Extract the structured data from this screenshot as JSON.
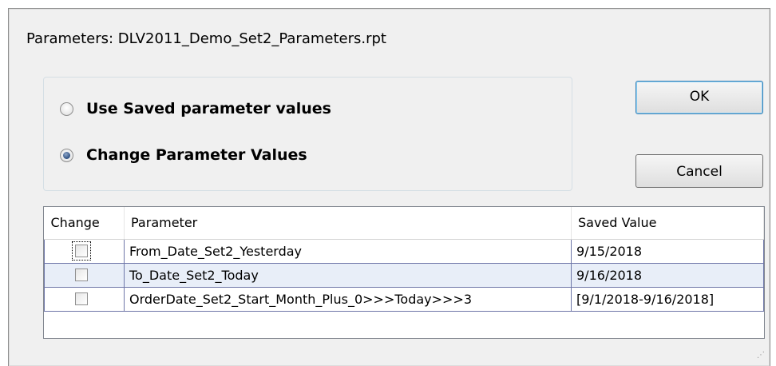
{
  "dialog": {
    "title": "Parameters: DLV2011_Demo_Set2_Parameters.rpt"
  },
  "options": [
    {
      "label": "Use Saved parameter values",
      "selected": false
    },
    {
      "label": "Change Parameter Values",
      "selected": true
    }
  ],
  "buttons": {
    "ok_label": "OK",
    "cancel_label": "Cancel"
  },
  "grid": {
    "headers": {
      "change": "Change",
      "parameter": "Parameter",
      "saved_value": "Saved Value"
    },
    "rows": [
      {
        "change": false,
        "parameter": "From_Date_Set2_Yesterday",
        "saved_value": "9/15/2018"
      },
      {
        "change": false,
        "parameter": "To_Date_Set2_Today",
        "saved_value": "9/16/2018"
      },
      {
        "change": false,
        "parameter": "OrderDate_Set2_Start_Month_Plus_0>>>Today>>>3",
        "saved_value": "[9/1/2018-9/16/2018]"
      }
    ]
  },
  "colors": {
    "dialog_bg": "#f0f0f0",
    "selected_row": "#e8eef8",
    "ok_border": "#3c7fb1"
  }
}
